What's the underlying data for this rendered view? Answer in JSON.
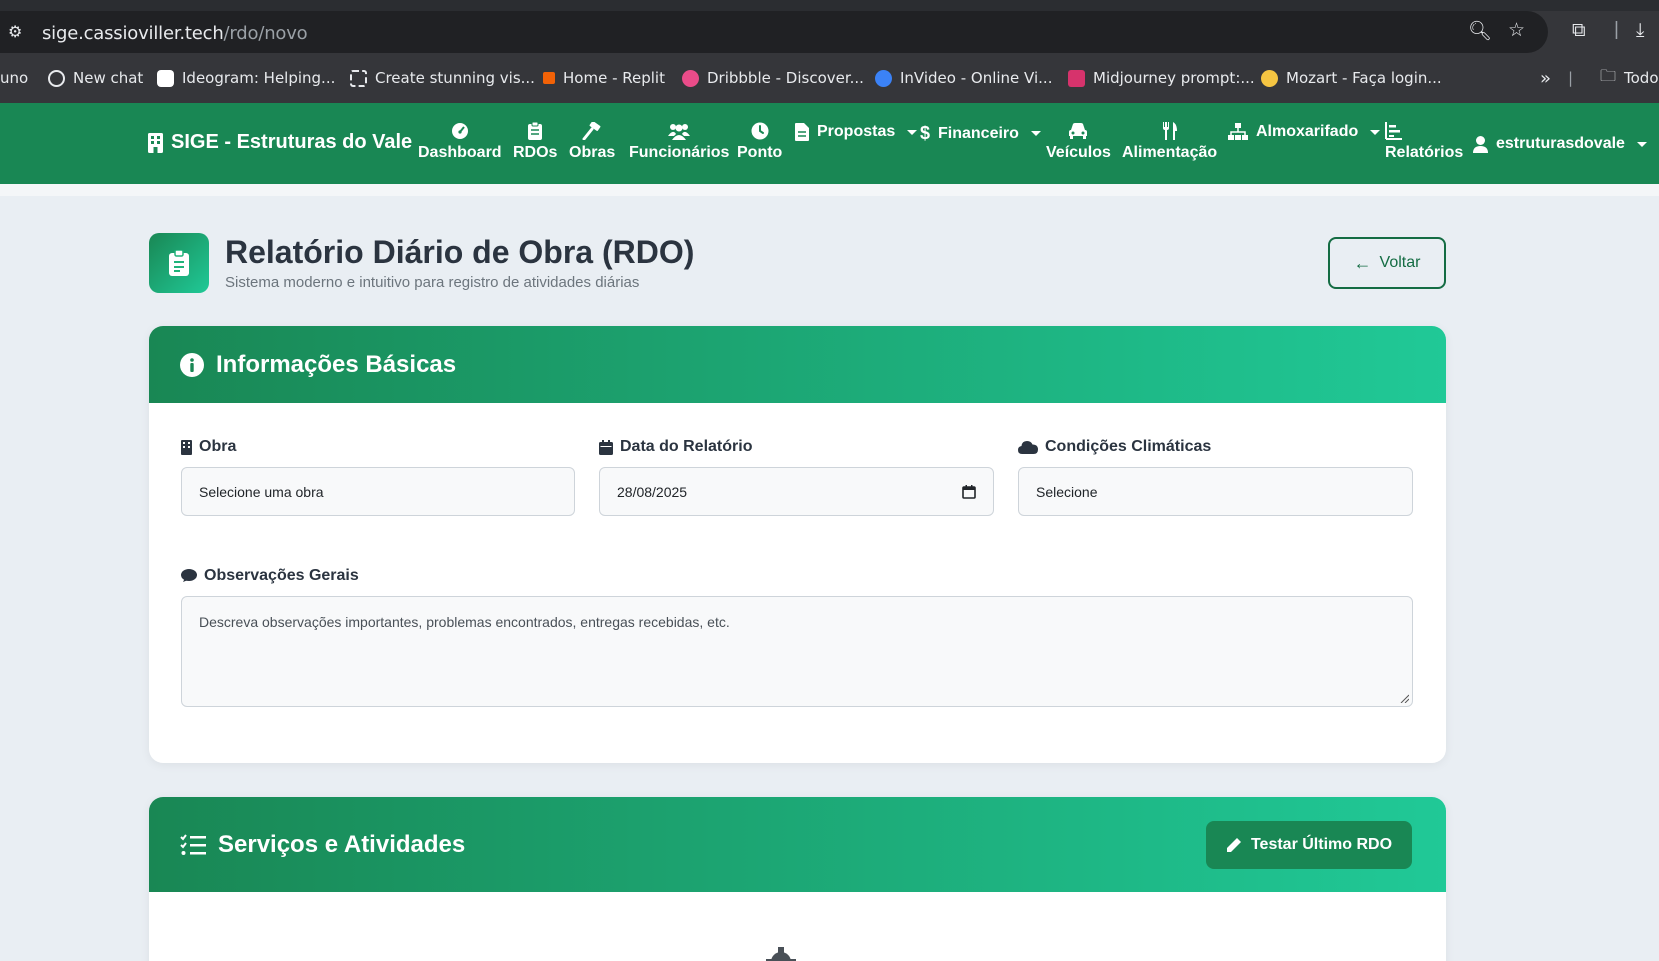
{
  "browser": {
    "url_host": "sige.cassioviller.tech",
    "url_path": "/rdo/novo",
    "bookmarks": [
      {
        "label": "uno",
        "color": ""
      },
      {
        "label": "New chat",
        "color": "#1f1f1f"
      },
      {
        "label": "Ideogram: Helping...",
        "color": "#ffffff"
      },
      {
        "label": "Create stunning vis...",
        "color": "#1f1f1f"
      },
      {
        "label": "Home - Replit",
        "color": "#f26207"
      },
      {
        "label": "Dribbble - Discover...",
        "color": "#ea4c89"
      },
      {
        "label": "InVideo - Online Vi...",
        "color": "#3b82f6"
      },
      {
        "label": "Midjourney prompt:...",
        "color": "#d6336c"
      },
      {
        "label": "Mozart - Faça login...",
        "color": "#f5c542"
      },
      {
        "label": "Todo",
        "color": ""
      }
    ],
    "more_label": "»"
  },
  "navbar": {
    "brand": "SIGE - Estruturas do Vale",
    "items": {
      "dashboard": "Dashboard",
      "rdos": "RDOs",
      "obras": "Obras",
      "funcionarios": "Funcionários",
      "ponto": "Ponto",
      "propostas": "Propostas",
      "financeiro": "Financeiro",
      "veiculos": "Veículos",
      "alimentacao": "Alimentação",
      "almoxarifado": "Almoxarifado",
      "relatorios": "Relatórios",
      "user": "estruturasdovale"
    },
    "color": "#198754"
  },
  "page": {
    "title": "Relatório Diário de Obra (RDO)",
    "subtitle": "Sistema moderno e intuitivo para registro de atividades diárias",
    "back_button": "Voltar"
  },
  "basic_info": {
    "header": "Informações Básicas",
    "obra_label": "Obra",
    "obra_value": "Selecione uma obra",
    "data_label": "Data do Relatório",
    "data_value": "28/08/2025",
    "clima_label": "Condições Climáticas",
    "clima_value": "Selecione",
    "obs_label": "Observações Gerais",
    "obs_placeholder": "Descreva observações importantes, problemas encontrados, entregas recebidas, etc."
  },
  "services": {
    "header": "Serviços e Atividades",
    "test_button": "Testar Último RDO"
  }
}
